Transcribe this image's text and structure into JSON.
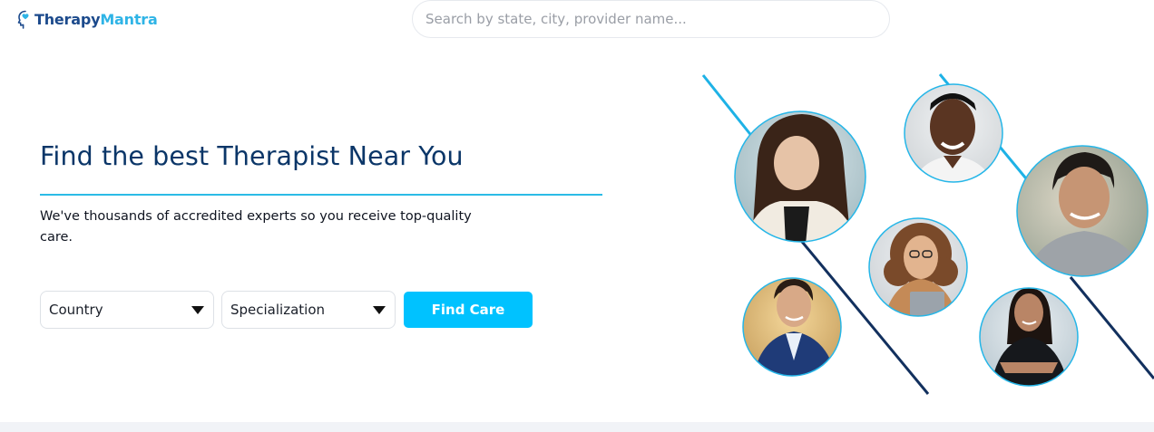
{
  "brand": {
    "name_part1": "Therapy",
    "name_part2": "Mantra",
    "colors": {
      "primary": "#1c4a8c",
      "accent": "#2fb4e6"
    },
    "icon": "head-heart-icon"
  },
  "search": {
    "placeholder": "Search by state, city, provider name...",
    "value": ""
  },
  "hero": {
    "title": "Find the best Therapist Near You",
    "subtitle": "We've thousands of accredited experts so you receive top-quality care.",
    "country_select": {
      "selected": "Country",
      "icon": "caret-down-icon"
    },
    "specialization_select": {
      "selected": "Specialization",
      "icon": "caret-down-icon"
    },
    "cta_label": "Find Care",
    "colors": {
      "title": "#0b3668",
      "rule": "#2bbbe6",
      "cta": "#00c2ff"
    }
  },
  "gallery": {
    "photos": [
      {
        "name": "therapist-photo-woman-asian"
      },
      {
        "name": "therapist-photo-man-smiling"
      },
      {
        "name": "therapist-photo-man-gray-shirt"
      },
      {
        "name": "therapist-photo-woman-curly-hair"
      },
      {
        "name": "therapist-photo-man-blue-suit"
      },
      {
        "name": "therapist-photo-woman-black-blazer"
      }
    ],
    "colors": {
      "line_light": "#1eb2e6",
      "line_dark": "#12305e",
      "ring": "#25b6e8"
    }
  }
}
